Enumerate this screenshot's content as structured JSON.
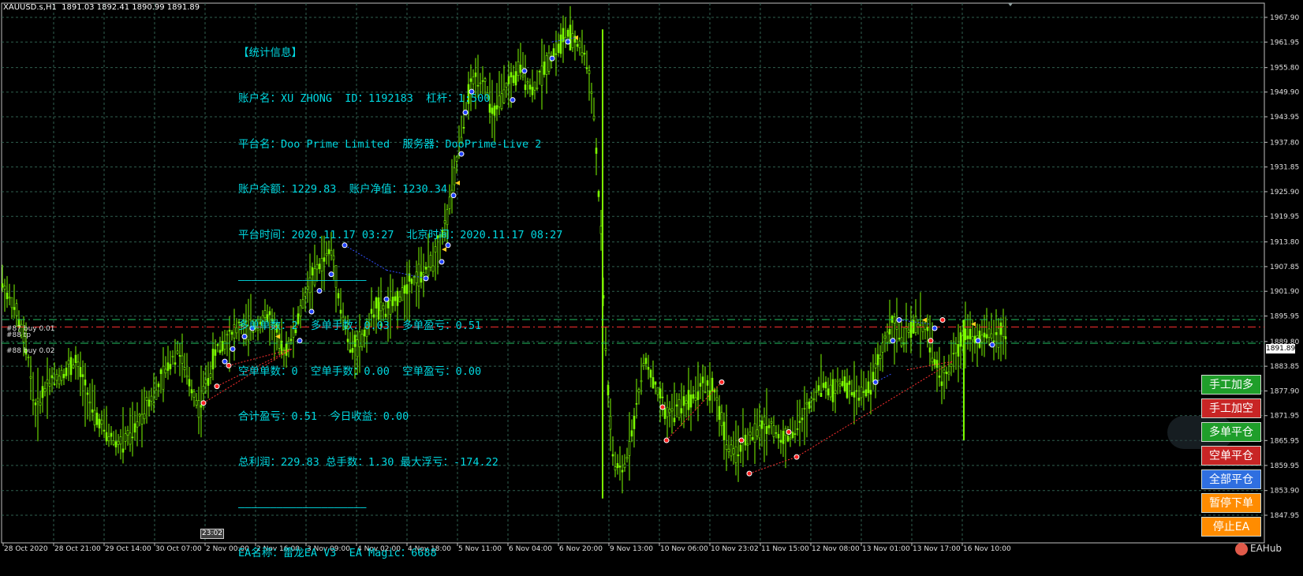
{
  "chart": {
    "symbol_line": "XAUUSD.s,H1  1891.03 1892.41 1890.99 1891.89",
    "current_price": "1891.89",
    "time_tag": "23:02",
    "y_min": 1844.0,
    "y_max": 1970.0,
    "price_labels": [
      "1967.90",
      "1961.95",
      "1955.80",
      "1949.90",
      "1943.95",
      "1937.80",
      "1931.85",
      "1925.90",
      "1919.95",
      "1913.80",
      "1907.85",
      "1901.90",
      "1895.95",
      "1889.80",
      "1883.85",
      "1877.90",
      "1871.95",
      "1865.95",
      "1859.95",
      "1853.90",
      "1847.95"
    ],
    "time_labels": [
      "28 Oct 2020",
      "28 Oct 21:00",
      "29 Oct 14:00",
      "30 Oct 07:00",
      "2 Nov 00:00",
      "2 Nov 16:00",
      "3 Nov 09:00",
      "4 Nov 02:00",
      "4 Nov 18:00",
      "5 Nov 11:00",
      "6 Nov 04:00",
      "6 Nov 20:00",
      "9 Nov 13:00",
      "10 Nov 06:00",
      "10 Nov 23:02",
      "11 Nov 15:00",
      "12 Nov 08:00",
      "13 Nov 01:00",
      "13 Nov 17:00",
      "16 Nov 10:00"
    ],
    "levels": [
      {
        "price": 1895.1,
        "color": "#20c060",
        "style": "dashed"
      },
      {
        "price": 1893.3,
        "color": "#ff3030",
        "style": "dashed"
      },
      {
        "price": 1889.4,
        "color": "#20c060",
        "style": "dashed"
      }
    ],
    "level_labels": [
      "#87 buy 0.01",
      "#88 tp",
      "#88 buy 0.02"
    ],
    "colors": {
      "candle": "#7CFC00",
      "grid": "#2f5f4f",
      "axis": "#c0c0c0"
    }
  },
  "stats": {
    "title": "【统计信息】",
    "account": "账户名：XU ZHONG  ID：1192183  杠杆：1:500",
    "platform": "平台名：Doo Prime Limited  服务器：DooPrime-Live 2",
    "balance": "账户余额：1229.83  账户净值：1230.34",
    "time": "平台时间：2020.11.17 03:27  北京时间：2020.11.17 08:27",
    "sep1": "————————————————————",
    "long": "多单单数：2  多单手数：0.03  多单盈亏：0.51",
    "short": "空单单数：0  空单手数：0.00  空单盈亏：0.00",
    "total": "合计盈亏：0.51  今日收益：0.00",
    "profit": "总利润：229.83 总手数：1.30 最大浮亏：-174.22",
    "sep2": "————————————————————",
    "ea": "EA名称：雷龙EA V3  EA Magic：6688"
  },
  "buttons": [
    {
      "label": "手工加多",
      "color": "#1f9e2a"
    },
    {
      "label": "手工加空",
      "color": "#c82525"
    },
    {
      "label": "多单平仓",
      "color": "#1f9e2a"
    },
    {
      "label": "空单平仓",
      "color": "#c82525"
    },
    {
      "label": "全部平仓",
      "color": "#2f6fe0"
    },
    {
      "label": "暂停下单",
      "color": "#ff8c00"
    },
    {
      "label": "停止EA",
      "color": "#ff8c00"
    }
  ],
  "watermark": "EAHub"
}
